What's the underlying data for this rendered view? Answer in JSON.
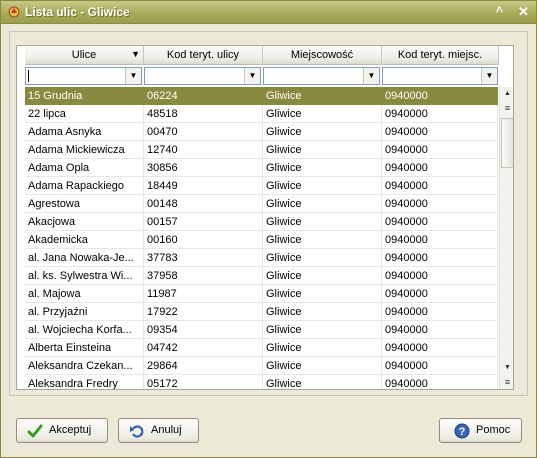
{
  "window": {
    "title": "Lista ulic - Gliwice",
    "minimize_glyph": "^",
    "close_glyph": "✕"
  },
  "grid": {
    "columns": [
      {
        "label": "Ulice",
        "sort": "▼"
      },
      {
        "label": "Kod teryt. ulicy"
      },
      {
        "label": "Miejscowość"
      },
      {
        "label": "Kod teryt. miejsc."
      }
    ],
    "filters": [
      "",
      "",
      "",
      ""
    ],
    "selected_row": 0,
    "rows": [
      [
        "15  Grudnia",
        "06224",
        "Gliwice",
        "0940000"
      ],
      [
        "22  lipca",
        "48518",
        "Gliwice",
        "0940000"
      ],
      [
        "Adama  Asnyka",
        "00470",
        "Gliwice",
        "0940000"
      ],
      [
        "Adama  Mickiewicza",
        "12740",
        "Gliwice",
        "0940000"
      ],
      [
        "Adama  Opla",
        "30856",
        "Gliwice",
        "0940000"
      ],
      [
        "Adama  Rapackiego",
        "18449",
        "Gliwice",
        "0940000"
      ],
      [
        "Agrestowa",
        "00148",
        "Gliwice",
        "0940000"
      ],
      [
        "Akacjowa",
        "00157",
        "Gliwice",
        "0940000"
      ],
      [
        "Akademicka",
        "00160",
        "Gliwice",
        "0940000"
      ],
      [
        "al. Jana  Nowaka-Je...",
        "37783",
        "Gliwice",
        "0940000"
      ],
      [
        "al. ks.  Sylwestra  Wi...",
        "37958",
        "Gliwice",
        "0940000"
      ],
      [
        "al.  Majowa",
        "11987",
        "Gliwice",
        "0940000"
      ],
      [
        "al.  Przyjaźni",
        "17922",
        "Gliwice",
        "0940000"
      ],
      [
        "al.  Wojciecha  Korfa...",
        "09354",
        "Gliwice",
        "0940000"
      ],
      [
        "Alberta  Einsteina",
        "04742",
        "Gliwice",
        "0940000"
      ],
      [
        "Aleksandra  Czekan...",
        "29864",
        "Gliwice",
        "0940000"
      ],
      [
        "Aleksandra  Fredry",
        "05172",
        "Gliwice",
        "0940000"
      ]
    ]
  },
  "buttons": {
    "accept": "Akceptuj",
    "cancel": "Anuluj",
    "help": "Pomoc"
  },
  "icons": {
    "app": "app-icon",
    "accept": "checkmark-icon",
    "cancel": "undo-icon",
    "help": "help-icon",
    "filter_dropdown": "chevron-down-icon",
    "scroll_up": "scroll-up-icon",
    "scroll_down": "scroll-down-icon"
  },
  "colors": {
    "titlebar": "#a9ab5b",
    "selection": "#8a8940",
    "checkmark": "#3a9a1e",
    "help": "#3a62b5"
  }
}
